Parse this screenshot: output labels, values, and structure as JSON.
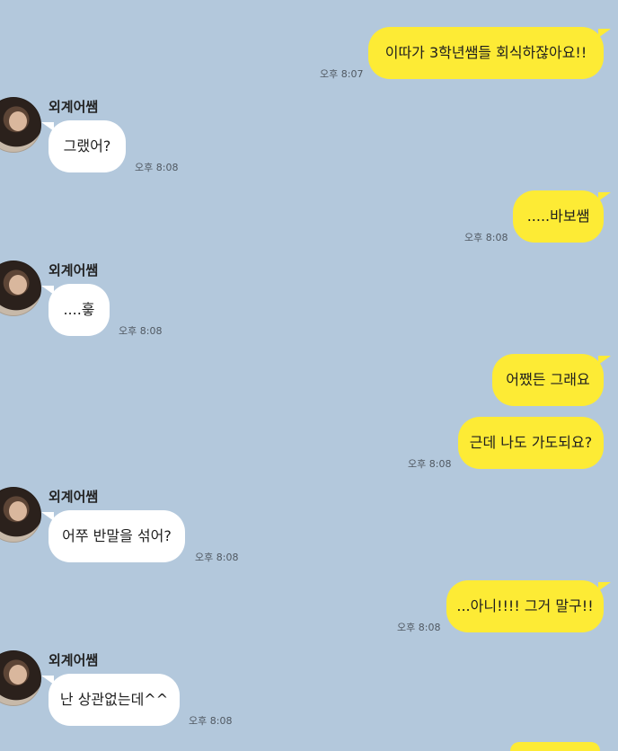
{
  "chat": {
    "background": "#b3c8dc",
    "my_bubble_color": "#fdeb35",
    "their_bubble_color": "#ffffff",
    "messages": [
      {
        "from": "me",
        "text": "이따가 3학년쌤들 회식하잖아요!!",
        "time": "오후 8:07"
      },
      {
        "from": "them",
        "sender": "외계어쌤",
        "text": "그랬어?",
        "time": "오후 8:08"
      },
      {
        "from": "me",
        "text": ".....바보쌤",
        "time": "오후 8:08"
      },
      {
        "from": "them",
        "sender": "외계어쌤",
        "text": "....흫",
        "time": "오후 8:08"
      },
      {
        "from": "me",
        "text": "어쨌든 그래요"
      },
      {
        "from": "me",
        "text": "근데 나도 가도되요?",
        "time": "오후 8:08"
      },
      {
        "from": "them",
        "sender": "외계어쌤",
        "text": "어쭈 반말을 섞어?",
        "time": "오후 8:08"
      },
      {
        "from": "me",
        "text": "...아니!!!! 그거 말구!!",
        "time": "오후 8:08"
      },
      {
        "from": "them",
        "sender": "외계어쌤",
        "text": "난 상관없는데^^",
        "time": "오후 8:08"
      }
    ]
  }
}
